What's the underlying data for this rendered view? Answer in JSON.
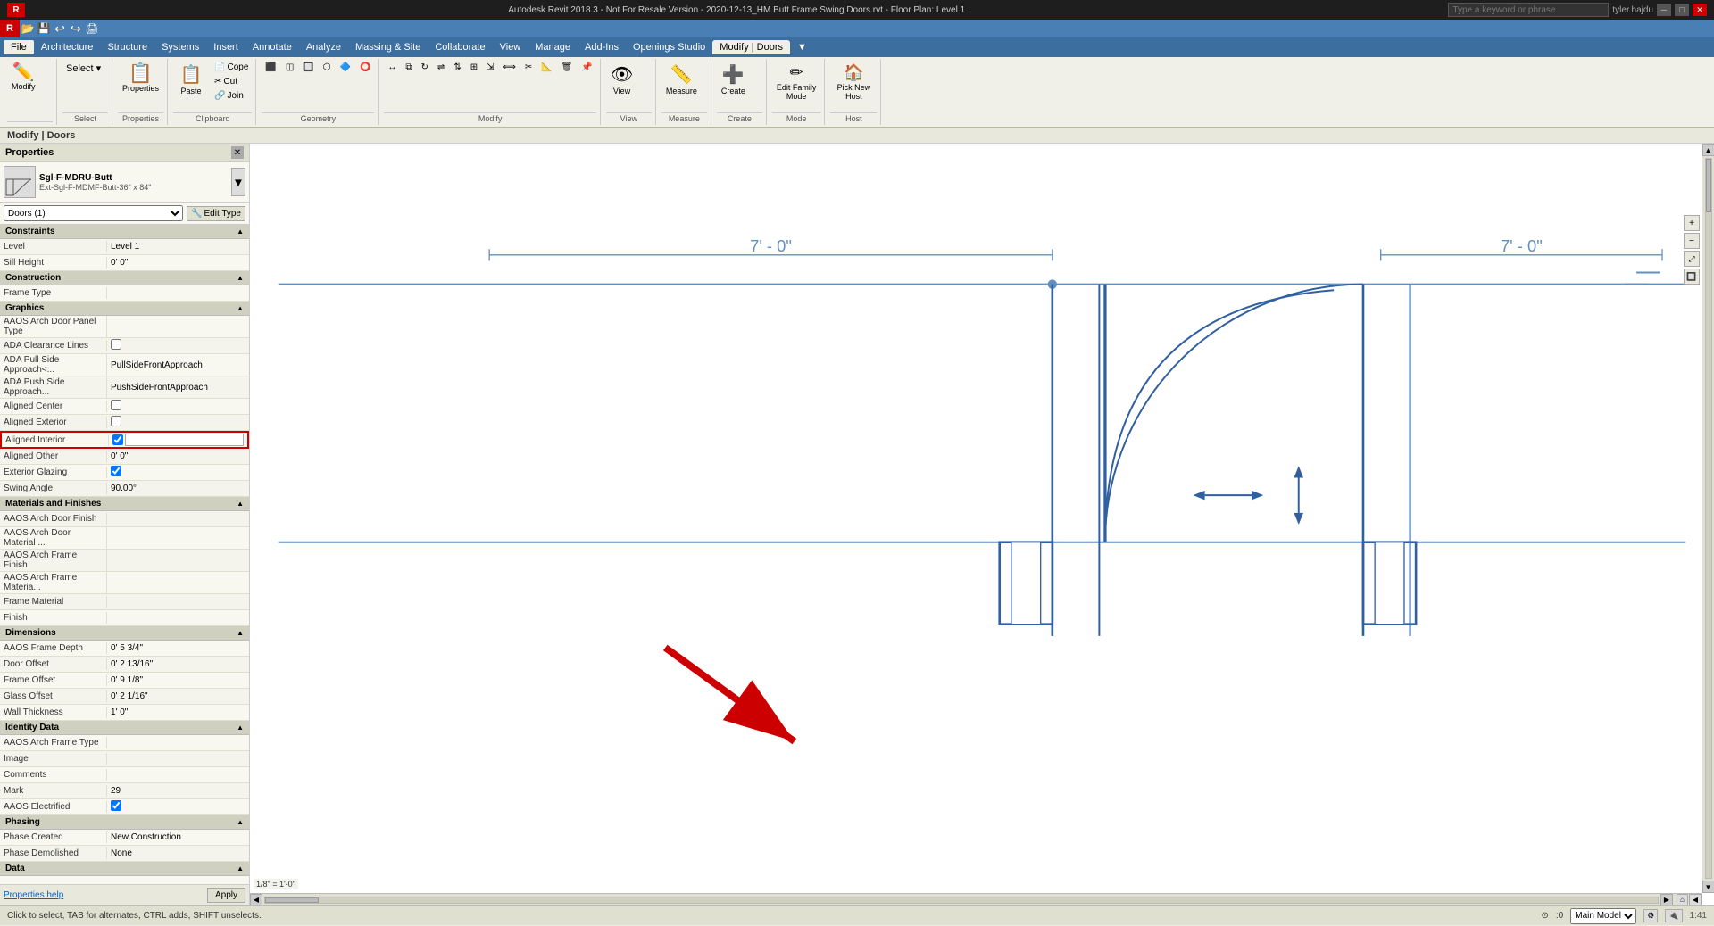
{
  "app": {
    "title": "Autodesk Revit 2018.3 - Not For Resale Version - 2020-12-13_HM Butt Frame Swing Doors.rvt - Floor Plan: Level 1",
    "user": "tyler.hajdu",
    "search_placeholder": "Type a keyword or phrase"
  },
  "titlebar": {
    "minimize": "─",
    "maximize": "□",
    "close": "✕"
  },
  "quickaccess": {
    "buttons": [
      "⟲",
      "⟳",
      "▶",
      "💾",
      "🖨"
    ]
  },
  "menubar": {
    "items": [
      "File",
      "Architecture",
      "Structure",
      "Systems",
      "Insert",
      "Annotate",
      "Analyze",
      "Massing & Site",
      "Collaborate",
      "View",
      "Manage",
      "Add-Ins",
      "Openings Studio",
      "Modify | Doors"
    ]
  },
  "ribbon": {
    "active_tab": "Modify | Doors",
    "panels": [
      {
        "label": "",
        "buttons_large": [
          {
            "icon": "✏",
            "label": "Modify"
          }
        ]
      },
      {
        "label": "Select",
        "buttons_large": [
          {
            "icon": "📋",
            "label": ""
          }
        ]
      },
      {
        "label": "Properties",
        "buttons_large": [
          {
            "icon": "⚙",
            "label": "Properties"
          }
        ]
      },
      {
        "label": "Clipboard",
        "buttons_small": [
          {
            "icon": "📋",
            "label": "Cope"
          },
          {
            "icon": "✂",
            "label": "Cut"
          },
          {
            "icon": "📌",
            "label": "Join"
          }
        ]
      },
      {
        "label": "Geometry",
        "buttons_small": []
      },
      {
        "label": "Modify",
        "buttons_large": []
      },
      {
        "label": "View",
        "buttons_large": []
      },
      {
        "label": "Measure",
        "buttons_large": []
      },
      {
        "label": "Create",
        "buttons_large": []
      },
      {
        "label": "Mode",
        "buttons_large": [
          {
            "icon": "✏",
            "label": "Edit\nFamily\nMode"
          }
        ]
      },
      {
        "label": "Host",
        "buttons_large": [
          {
            "icon": "🏠",
            "label": "Pick\nNew\nHost"
          }
        ]
      }
    ]
  },
  "breadcrumb": "Modify | Doors",
  "properties_panel": {
    "title": "Properties",
    "type_name": "Sgl-F-MDRU-Butt",
    "type_desc": "Ext-Sgl-F-MDMF-Butt-36\" x 84\"",
    "instance_label": "Doors (1)",
    "edit_type_label": "Edit Type",
    "sections": [
      {
        "name": "Constraints",
        "rows": [
          {
            "name": "Level",
            "value": "Level 1",
            "type": "text"
          },
          {
            "name": "Sill Height",
            "value": "0' 0\"",
            "type": "text"
          },
          {
            "name": "Construction",
            "value": "",
            "type": "text"
          }
        ]
      },
      {
        "name": "Graphics",
        "rows": [
          {
            "name": "AAOS Arch Door Panel Type",
            "value": "",
            "type": "text"
          },
          {
            "name": "ADA Clearance Lines",
            "value": "",
            "type": "checkbox",
            "checked": false
          },
          {
            "name": "ADA Pull Side Approach<...",
            "value": "PullSideFrontApproach",
            "type": "text"
          },
          {
            "name": "ADA Push Side Approach...",
            "value": "PushSideFrontApproach",
            "type": "text"
          },
          {
            "name": "Aligned Center",
            "value": "",
            "type": "checkbox",
            "checked": false
          },
          {
            "name": "Aligned Exterior",
            "value": "",
            "type": "checkbox",
            "checked": false
          },
          {
            "name": "Aligned Interior",
            "value": "",
            "type": "checkbox",
            "checked": true
          },
          {
            "name": "Aligned Other",
            "value": "0' 0\"",
            "type": "text"
          },
          {
            "name": "Exterior Glazing",
            "value": "",
            "type": "checkbox",
            "checked": true
          },
          {
            "name": "Swing Angle",
            "value": "90.00°",
            "type": "text"
          }
        ]
      },
      {
        "name": "Materials and Finishes",
        "rows": [
          {
            "name": "AAOS Arch Door Finish",
            "value": "",
            "type": "text"
          },
          {
            "name": "AAOS Arch Door Material ...",
            "value": "",
            "type": "text"
          },
          {
            "name": "AAOS Arch Frame Finish",
            "value": "",
            "type": "text"
          },
          {
            "name": "AAOS Arch Frame Materia...",
            "value": "",
            "type": "text"
          },
          {
            "name": "Frame Material",
            "value": "",
            "type": "text"
          },
          {
            "name": "Finish",
            "value": "",
            "type": "text"
          }
        ]
      },
      {
        "name": "Dimensions",
        "rows": [
          {
            "name": "AAOS Frame Depth",
            "value": "0' 5 3/4\"",
            "type": "text"
          },
          {
            "name": "Door Offset",
            "value": "0' 2 13/16\"",
            "type": "text"
          },
          {
            "name": "Frame Offset",
            "value": "0' 9 1/8\"",
            "type": "text"
          },
          {
            "name": "Glass Offset",
            "value": "0' 2 1/16\"",
            "type": "text"
          },
          {
            "name": "Wall Thickness",
            "value": "1' 0\"",
            "type": "text"
          }
        ]
      },
      {
        "name": "Identity Data",
        "rows": [
          {
            "name": "AAOS Arch Frame Type",
            "value": "",
            "type": "text"
          },
          {
            "name": "Image",
            "value": "",
            "type": "text"
          },
          {
            "name": "Comments",
            "value": "",
            "type": "text"
          },
          {
            "name": "Mark",
            "value": "29",
            "type": "text"
          },
          {
            "name": "AAOS Electrified",
            "value": "",
            "type": "checkbox",
            "checked": true
          }
        ]
      },
      {
        "name": "Phasing",
        "rows": [
          {
            "name": "Phase Created",
            "value": "New Construction",
            "type": "text"
          },
          {
            "name": "Phase Demolished",
            "value": "None",
            "type": "text"
          }
        ]
      },
      {
        "name": "Data",
        "rows": []
      }
    ],
    "footer": {
      "help_link": "Properties help",
      "apply_label": "Apply"
    }
  },
  "canvas": {
    "dimension_left": "7' - 0\"",
    "dimension_right": "7' - 0\"",
    "scale": "1/8\" = 1'-0\""
  },
  "statusbar": {
    "message": "Click to select, TAB for alternates, CTRL adds, SHIFT unselects.",
    "angle": ":0",
    "view_mode": "Main Model"
  },
  "viewcube": {
    "label": "▣"
  }
}
